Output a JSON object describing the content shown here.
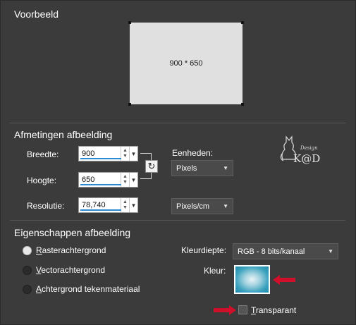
{
  "preview": {
    "title": "Voorbeeld",
    "size_text": "900 * 650"
  },
  "dimensions": {
    "title": "Afmetingen afbeelding",
    "width_label": "Breedte:",
    "width_value": "900",
    "height_label": "Hoogte:",
    "height_value": "650",
    "resolution_label": "Resolutie:",
    "resolution_value": "78,740",
    "units_label": "Eenheden:",
    "units_value": "Pixels",
    "resolution_units_value": "Pixels/cm",
    "link_icon": "link-aspect-icon"
  },
  "properties": {
    "title": "Eigenschappen afbeelding",
    "radio_options": [
      {
        "accel": "R",
        "rest": "asterachtergrond",
        "selected": true
      },
      {
        "accel": "V",
        "rest": "ectorachtergrond",
        "selected": false
      },
      {
        "accel": "A",
        "rest": "chtergrond tekenmateriaal",
        "selected": false
      }
    ],
    "color_depth_label": "Kleurdiepte:",
    "color_depth_value": "RGB - 8 bits/kanaal",
    "color_label": "Kleur:",
    "transparent_accel": "T",
    "transparent_rest": "ransparant",
    "transparent_checked": false
  },
  "logo": {
    "text": "K@D",
    "small_text": "Design"
  },
  "colors": {
    "background": "#3b3b3b",
    "accent_underline": "#2a8ad4",
    "annotation_arrow": "#d0102a"
  }
}
